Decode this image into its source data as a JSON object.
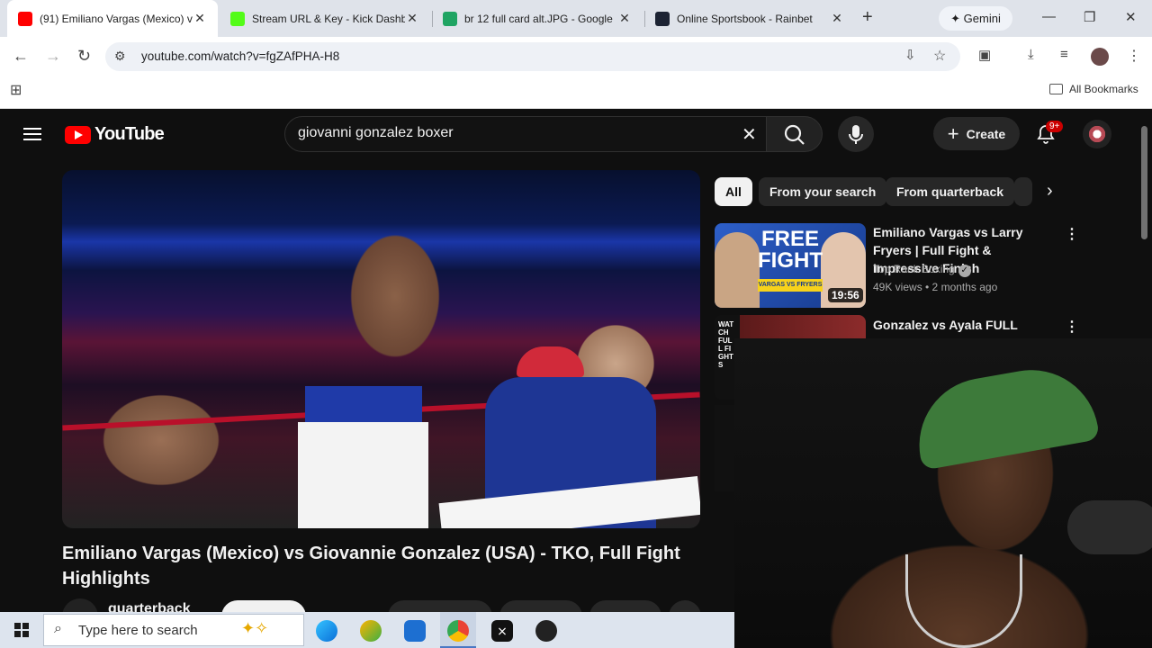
{
  "browser": {
    "tabs": [
      {
        "title": "(91) Emiliano Vargas (Mexico) v",
        "favicon_color": "#ff0000"
      },
      {
        "title": "Stream URL & Key - Kick Dashb",
        "favicon_color": "#53fc18"
      },
      {
        "title": "br 12 full card alt.JPG - Google",
        "favicon_color": "#1fa463"
      },
      {
        "title": "Online Sportsbook - Rainbet",
        "favicon_color": "#1c2333"
      }
    ],
    "gemini_label": "Gemini",
    "url": "youtube.com/watch?v=fgZAfPHA-H8",
    "all_bookmarks": "All Bookmarks"
  },
  "youtube": {
    "logo_text": "YouTube",
    "search_value": "giovanni gonzalez boxer",
    "create_label": "Create",
    "notif_badge": "9+",
    "video_title": "Emiliano Vargas (Mexico) vs Giovannie Gonzalez (USA) - TKO, Full Fight Highlights",
    "channel_name": "quarterback",
    "chips": [
      "All",
      "From your search",
      "From quarterback"
    ],
    "recommendations": [
      {
        "title": "Emiliano Vargas vs Larry Fryers | Full Fight & Impressive Finish",
        "channel": "Top Rank Boxing",
        "meta": "49K views • 2 months ago",
        "duration": "19:56",
        "thumb_text": "FREE FIGHT",
        "thumb_sub": "VARGAS VS FRYERS"
      },
      {
        "title": "Gonzalez vs Ayala FULL FIGHT:",
        "thumb_text": "WATCH FULL FIGHTS"
      }
    ]
  },
  "taskbar": {
    "search_placeholder": "Type here to search"
  }
}
